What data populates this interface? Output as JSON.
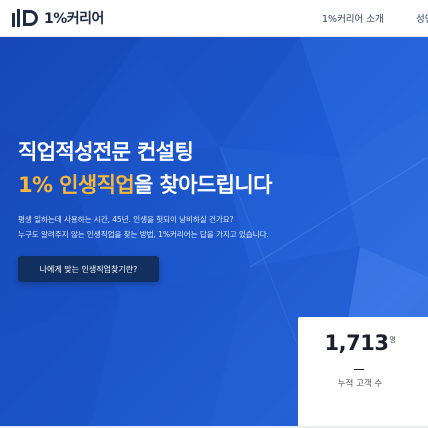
{
  "header": {
    "logo_text": "1%커리어",
    "nav": [
      "1%커리어 소개",
      "성인"
    ]
  },
  "hero": {
    "headline_line1": "직업적성전문 컨설팅",
    "headline_line2_highlight": "1% 인생직업",
    "headline_line2_rest": "을 찾아드립니다",
    "desc_line1": "평생 일하는데 사용하는 시간, 45년. 인생을 헛되이 낭비하실 건가요?",
    "desc_line2": "누구도 알려주지 않는 인생직업을 찾는 방법, 1%커리어는 답을 가지고 있습니다.",
    "cta_label": "나에게 맞는 인생직업찾기란?"
  },
  "stat": {
    "value": "1,713",
    "unit": "명",
    "label": "누적 고객 수"
  },
  "colors": {
    "hero_blue": "#1e5cd6",
    "highlight": "#f6b73c",
    "cta_bg": "#12305f",
    "logo_text": "#1f2a44"
  }
}
